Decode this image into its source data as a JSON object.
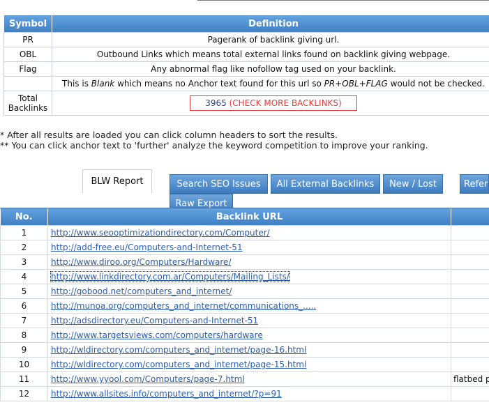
{
  "legend": {
    "headers": {
      "symbol": "Symbol",
      "definition": "Definition"
    },
    "rows": [
      {
        "symbol": "PR",
        "definition": "Pagerank of backlink giving url."
      },
      {
        "symbol": "OBL",
        "definition": "Outbound Links which means total external links found on backlink giving webpage."
      },
      {
        "symbol": "Flag",
        "definition": "Any abnormal flag like nofollow tag used on your backlink."
      }
    ],
    "blank_row": {
      "pre": "This is ",
      "blank": "Blank",
      "mid": " which means no Anchor text found for this url so ",
      "emph": "PR+OBL+FLAG",
      "post": " would not be checked."
    },
    "total": {
      "label_line1": "Total",
      "label_line2": "Backlinks",
      "count": "3965",
      "link": " (CHECK MORE BACKLINKS)"
    }
  },
  "notes": [
    "* After all results are loaded you can click column headers to sort the results.",
    "** You can click anchor text to 'further' analyze the keyword competition to improve your ranking."
  ],
  "tabs": {
    "active": "BLW Report",
    "buttons": [
      "Search SEO Issues",
      "All External Backlinks",
      "New / Lost",
      "Refer"
    ],
    "raw_export": "Raw Export"
  },
  "results": {
    "headers": {
      "no": "No.",
      "url": "Backlink URL"
    },
    "rows": [
      {
        "no": "1",
        "url": "http://www.seooptimizationdirectory.com/Computer/",
        "extra": ""
      },
      {
        "no": "2",
        "url": "http://add-free.eu/Computers-and-Internet-51",
        "extra": ""
      },
      {
        "no": "3",
        "url": "http://www.diroo.org/Computers/Hardware/",
        "extra": ""
      },
      {
        "no": "4",
        "url": "http://www.linkdirectory.com.ar/Computers/Mailing_Lists/",
        "extra": ""
      },
      {
        "no": "5",
        "url": "http://gobood.net/computers_and_internet/",
        "extra": ""
      },
      {
        "no": "6",
        "url": "http://munoa.org/computers_and_internet/communications_.....",
        "extra": ""
      },
      {
        "no": "7",
        "url": "http://adsdirectory.eu/Computers-and-Internet-51",
        "extra": ""
      },
      {
        "no": "8",
        "url": "http://www.targetsviews.com/computers/hardware",
        "extra": ""
      },
      {
        "no": "9",
        "url": "http://wldirectory.com/computers_and_internet/page-16.html",
        "extra": ""
      },
      {
        "no": "10",
        "url": "http://wldirectory.com/computers_and_internet/page-15.html",
        "extra": ""
      },
      {
        "no": "11",
        "url": "http://www.yyool.com/Computers/page-7.html",
        "extra": "flatbed p"
      },
      {
        "no": "12",
        "url": "http://www.allsites.info/computers_and_internet/?p=91",
        "extra": ""
      }
    ]
  }
}
